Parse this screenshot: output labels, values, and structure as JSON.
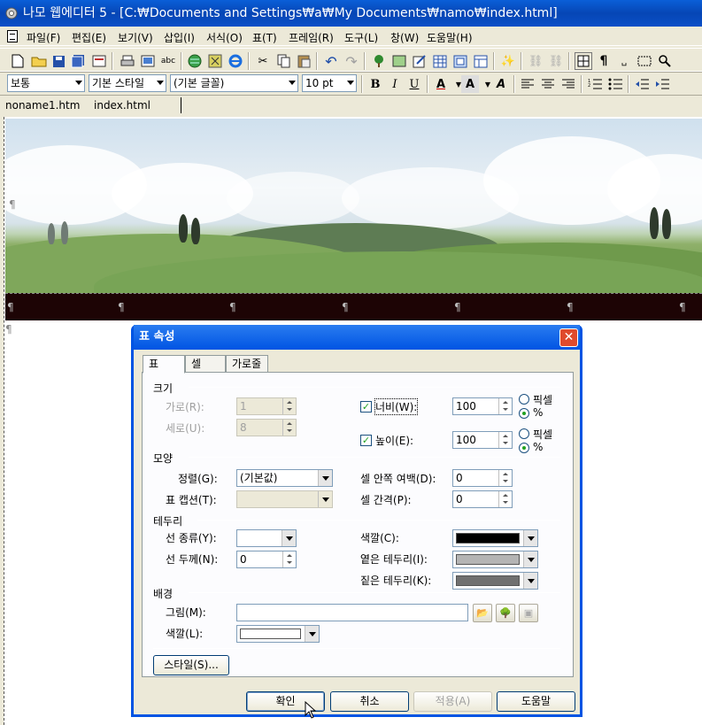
{
  "window": {
    "title": "나모 웹에디터 5 - [C:₩Documents and Settings₩a₩My Documents₩namo₩index.html]"
  },
  "menu": [
    "파일(F)",
    "편집(E)",
    "보기(V)",
    "삽입(I)",
    "서식(O)",
    "표(T)",
    "프레임(R)",
    "도구(L)",
    "창(W)",
    "도움말(H)"
  ],
  "format_toolbar": {
    "paragraph_style": "보통",
    "base_style": "기본 스타일",
    "font": "(기본 글꼴)",
    "font_size": "10 pt",
    "bold": "B",
    "italic": "I",
    "underline": "U",
    "font_color": "A"
  },
  "tabs": [
    "noname1.htm",
    "index.html"
  ],
  "paragraph_mark": "¶",
  "dialog": {
    "title": "표 속성",
    "close": "✕",
    "tabs": [
      "표",
      "셀",
      "가로줄"
    ],
    "groups": {
      "size": "크기",
      "shape": "모양",
      "border": "테두리",
      "background": "배경"
    },
    "size": {
      "cols_label": "가로(R):",
      "cols_value": "1",
      "rows_label": "세로(U):",
      "rows_value": "8",
      "width_label": "너비(W):",
      "width_value": "100",
      "width_checked": "✓",
      "height_label": "높이(E):",
      "height_value": "100",
      "height_checked": "✓",
      "unit_pixel": "픽셀",
      "unit_percent": "%"
    },
    "shape": {
      "align_label": "정렬(G):",
      "align_value": "(기본값)",
      "caption_label": "표 캡션(T):",
      "caption_value": "",
      "padding_label": "셀 안쪽 여백(D):",
      "padding_value": "0",
      "spacing_label": "셀 간격(P):",
      "spacing_value": "0"
    },
    "border": {
      "type_label": "선 종류(Y):",
      "type_value": "",
      "thickness_label": "선 두께(N):",
      "thickness_value": "0",
      "color_label": "색깔(C):",
      "color": "#000000",
      "light_label": "옅은 테두리(I):",
      "light_color": "#b4b4b4",
      "dark_label": "짙은 테두리(K):",
      "dark_color": "#707070"
    },
    "background": {
      "image_label": "그림(M):",
      "image_value": "",
      "color_label": "색깔(L):",
      "color": "#ffffff"
    },
    "style_button": "스타일(S)...",
    "buttons": {
      "ok": "확인",
      "cancel": "취소",
      "apply": "적용(A)",
      "help": "도움말"
    }
  }
}
